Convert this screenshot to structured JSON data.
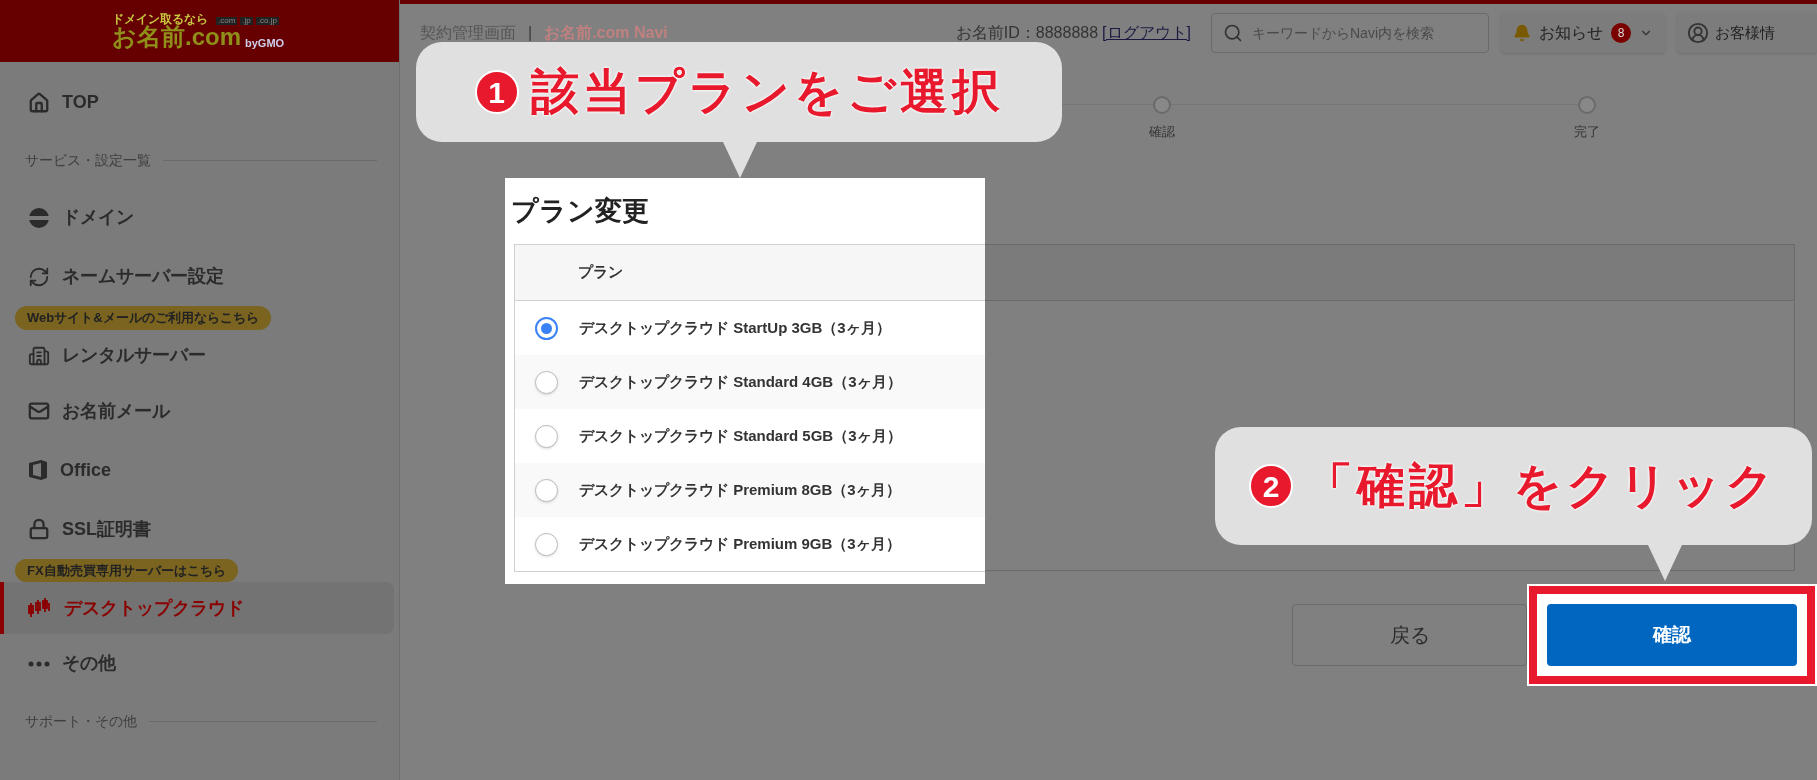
{
  "header": {
    "logo": {
      "tagline": "ドメイン取るなら",
      "name": "お名前.com",
      "tlds": [
        ".com",
        ".jp",
        ".co.jp"
      ],
      "maker": "byGMO"
    }
  },
  "sidebar": {
    "items": [
      {
        "kind": "link",
        "label": "TOP",
        "selected": false
      },
      {
        "kind": "section",
        "label": "サービス・設定一覧"
      },
      {
        "kind": "link",
        "label": "ドメイン",
        "selected": false
      },
      {
        "kind": "link",
        "label": "ネームサーバー設定",
        "selected": false
      },
      {
        "kind": "link",
        "label": "レンタルサーバー",
        "badge": "Webサイト&メールのご利用ならこちら",
        "selected": false
      },
      {
        "kind": "link",
        "label": "お名前メール",
        "selected": false
      },
      {
        "kind": "link",
        "label": "Office",
        "selected": false
      },
      {
        "kind": "link",
        "label": "SSL証明書",
        "selected": false
      },
      {
        "kind": "link",
        "label": "デスクトップクラウド",
        "badge": "FX自動売買専用サーバーはこちら",
        "selected": true
      },
      {
        "kind": "link",
        "label": "その他",
        "selected": false
      },
      {
        "kind": "section",
        "label": "サポート・その他"
      }
    ]
  },
  "topbar": {
    "breadcrumb": [
      "契約管理画面",
      "お名前.com Navi"
    ],
    "separator": "|",
    "user_id": "お名前ID：8888888",
    "logout": "[ログアウト]",
    "search": {
      "placeholder": "キーワードからNavi内を検索"
    },
    "notifications": {
      "label": "お知らせ",
      "count": "8"
    },
    "account": "お客様情"
  },
  "steps": [
    {
      "label": "確認"
    },
    {
      "label": "完了"
    }
  ],
  "plan_change": {
    "title": "プラン変更",
    "column": "プラン",
    "plans": [
      {
        "label": "デスクトップクラウド StartUp 3GB（3ヶ月）",
        "selected": true
      },
      {
        "label": "デスクトップクラウド Standard 4GB（3ヶ月）",
        "selected": false
      },
      {
        "label": "デスクトップクラウド Standard 5GB（3ヶ月）",
        "selected": false
      },
      {
        "label": "デスクトップクラウド Premium 8GB（3ヶ月）",
        "selected": false
      },
      {
        "label": "デスクトップクラウド Premium 9GB（3ヶ月）",
        "selected": false
      }
    ]
  },
  "buttons": {
    "back": "戻る",
    "confirm": "確認"
  },
  "callouts": [
    {
      "number": "1",
      "text": "該当プランをご選択"
    },
    {
      "number": "2",
      "text": "「確認」をクリック"
    }
  ]
}
